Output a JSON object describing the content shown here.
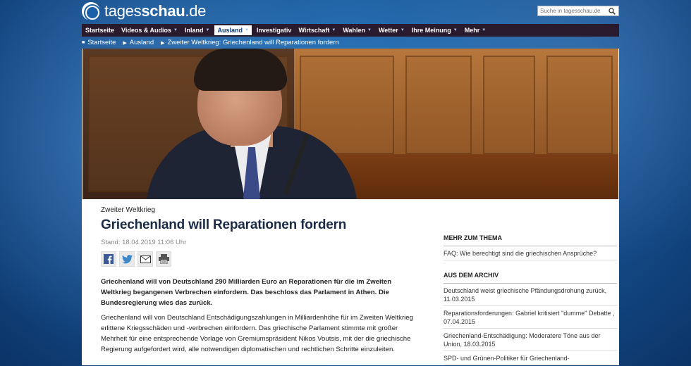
{
  "site": {
    "logo_prefix": "tages",
    "logo_suffix": "schau",
    "logo_tld": ".de"
  },
  "search": {
    "placeholder": "Suche in tagesschau.de"
  },
  "nav": {
    "items": [
      {
        "label": "Startseite",
        "caret": false
      },
      {
        "label": "Videos & Audios",
        "caret": true
      },
      {
        "label": "Inland",
        "caret": true
      },
      {
        "label": "Ausland",
        "caret": true
      },
      {
        "label": "Investigativ",
        "caret": false
      },
      {
        "label": "Wirtschaft",
        "caret": true
      },
      {
        "label": "Wahlen",
        "caret": true
      },
      {
        "label": "Wetter",
        "caret": true
      },
      {
        "label": "Ihre Meinung",
        "caret": true
      },
      {
        "label": "Mehr",
        "caret": true
      }
    ],
    "active": "Ausland"
  },
  "breadcrumb": [
    "Startseite",
    "Ausland",
    "Zweiter Weltkrieg: Griechenland will Reparationen fordern"
  ],
  "article": {
    "topline": "Zweiter Weltkrieg",
    "headline": "Griechenland will Reparationen fordern",
    "stand": "Stand: 18.04.2019 11:06 Uhr",
    "lead": "Griechenland will von Deutschland 290 Milliarden Euro an Reparationen für die im Zweiten Weltkrieg begangenen Verbrechen einfordern. Das beschloss das Parlament in Athen. Die Bundesregierung wies das zurück.",
    "body": "Griechenland will von Deutschland Entschädigungszahlungen in Milliardenhöhe für im Zweiten Weltkrieg erlittene Kriegsschäden und -verbrechen einfordern. Das griechische Parlament stimmte mit großer Mehrheit für eine entsprechende Vorlage von Gremiumspräsident Nikos Voutsis, mit der die griechische Regierung aufgefordert wird, alle notwendigen diplomatischen und rechtlichen Schritte einzuleiten."
  },
  "sidebar": {
    "mehr_title": "Mehr zum Thema",
    "mehr_items": [
      "FAQ: Wie berechtigt sind die griechischen Ansprüche?"
    ],
    "archiv_title": "Aus dem Archiv",
    "archiv_items": [
      "Deutschland weist griechische Pfändungsdrohung zurück, 11.03.2015",
      "Reparationsforderungen: Gabriel kritisiert \"dumme\" Debatte , 07.04.2015",
      "Griechenland-Entschädigung: Moderatere Töne aus der Union, 18.03.2015",
      "SPD- und Grünen-Politiker für Griechenland-"
    ]
  },
  "colors": {
    "nav_bg": "#2a1a2e",
    "headline": "#1b2b45",
    "background": "#17508f"
  }
}
